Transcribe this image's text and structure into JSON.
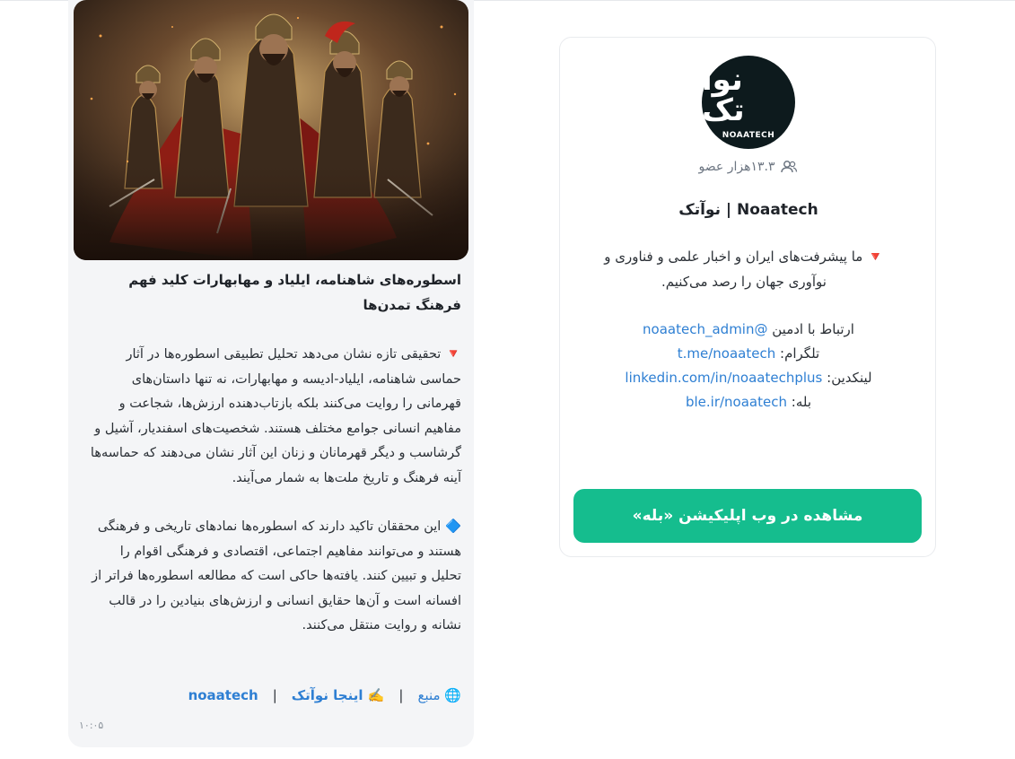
{
  "channel": {
    "logo": {
      "mark": "نوآ تک",
      "text": "NOAATECH"
    },
    "members_icon": "users-icon",
    "members": "۱۳.۳هزار عضو",
    "title": "Noaatech | نوآتک",
    "description": "🔻 ما پیشرفت‌های ایران و اخبار علمی و فناوری و نوآوری جهان را رصد می‌کنیم.",
    "contacts": [
      {
        "label": "ارتباط با ادمین",
        "link": "@noaatech_admin"
      },
      {
        "label": "تلگرام:",
        "link": "t.me/noaatech"
      },
      {
        "label": "لینکدین:",
        "link": "linkedin.com/in/noaatechplus"
      },
      {
        "label": "بله:",
        "link": "ble.ir/noaatech"
      }
    ],
    "open_button": "مشاهده در وب اپلیکیشن «بله»",
    "button_color": "#15bd8e",
    "link_color": "#2e7fd3"
  },
  "post": {
    "image_subject": "warriors-illustration",
    "title": "اسطوره‌های شاهنامه، ایلیاد و مهابهارات کلید فهم فرهنگ تمدن‌ها",
    "paragraph1": "🔻 تحقیقی تازه نشان می‌دهد تحلیل تطبیقی اسطوره‌ها در آثار حماسی شاهنامه، ایلیاد-ادیسه و مهابهارات، نه تنها داستان‌های قهرمانی را روایت می‌کنند بلکه بازتاب‌دهنده ارزش‌ها، شجاعت و مفاهیم انسانی جوامع مختلف هستند. شخصیت‌های اسفندیار، آشیل و گرشاسب و دیگر قهرمانان و زنان این آثار نشان می‌دهند که حماسه‌ها آینه فرهنگ و تاریخ ملت‌ها به شمار می‌آیند.",
    "paragraph2": "🔷 این محققان تاکید دارند که اسطوره‌ها نمادهای تاریخی و فرهنگی هستند و می‌توانند مفاهیم اجتماعی، اقتصادی و فرهنگی اقوام را تحلیل و تبیین کنند. یافته‌ها حاکی است که مطالعه اسطوره‌ها فراتر از افسانه است و آن‌ها حقایق انسانی و ارزش‌های بنیادین را در قالب نشانه و روایت منتقل می‌کنند.",
    "footer": {
      "source": "🌐 منبع",
      "separator": "|",
      "here_label": "✍️ اینجا نوآتک",
      "handle": "noaatech"
    },
    "time": "۱۰:۰۵"
  }
}
